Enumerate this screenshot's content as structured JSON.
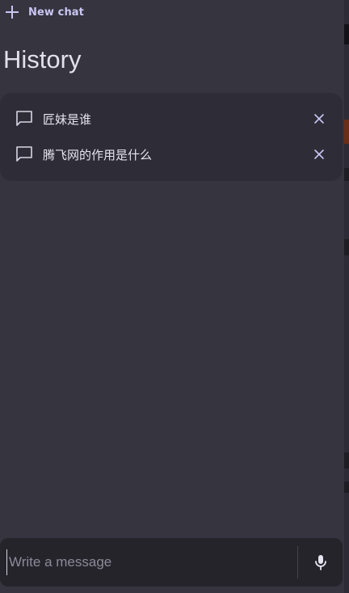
{
  "sidebar": {
    "new_chat_label": "New chat",
    "history_title": "History",
    "history_items": [
      {
        "label": "匠妹是谁"
      },
      {
        "label": "腾飞网的作用是什么"
      }
    ]
  },
  "composer": {
    "placeholder": "Write a message",
    "mic_icon": "microphone-icon"
  },
  "icons": {
    "new_chat": "plus-icon",
    "history_item": "chat-bubble-icon",
    "remove": "close-icon"
  },
  "colors": {
    "background": "#35343f",
    "card": "#2e2d37",
    "composer": "#25242b",
    "accent": "#c9c6f2",
    "text": "#e6e4ee",
    "placeholder": "#8c8a98"
  }
}
